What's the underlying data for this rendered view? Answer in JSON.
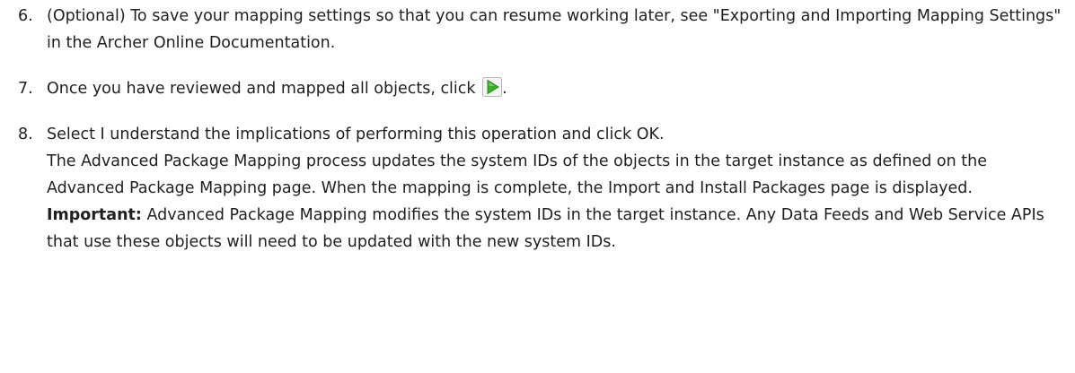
{
  "steps": [
    {
      "number": "6.",
      "text": "(Optional) To save your mapping settings so that you can resume working later, see \"Exporting and Importing Mapping Settings\" in the Archer Online Documentation."
    },
    {
      "number": "7.",
      "text_before": "Once you have reviewed and mapped all objects, click",
      "text_after": ".",
      "icon": "play-arrow-icon"
    },
    {
      "number": "8.",
      "text": "Select I understand the implications of performing this operation and click OK.",
      "detail": "The Advanced Package Mapping process updates the system IDs of the objects in the target instance as defined on the Advanced Package Mapping page. When the mapping is complete, the Import and Install Packages page is displayed.",
      "important_label": "Important:",
      "important_text": " Advanced Package Mapping modifies the system IDs in the target instance. Any Data Feeds and Web Service APIs that use these objects will need to be updated with the new system IDs."
    }
  ],
  "colors": {
    "text": "#1f1f1f",
    "icon_green": "#3cae2a",
    "icon_border": "#b9b9b9"
  }
}
